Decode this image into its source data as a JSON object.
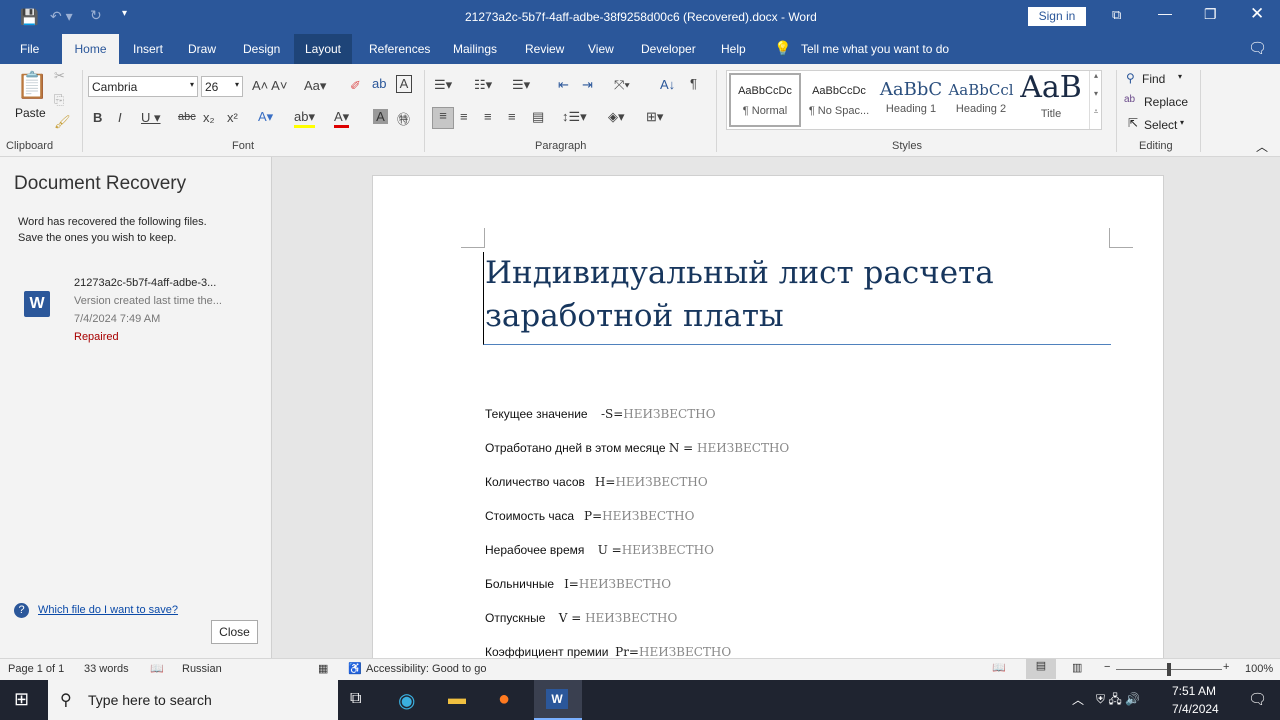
{
  "title": "21273a2c-5b7f-4aff-adbe-38f9258d00c6 (Recovered).docx  -  Word",
  "sign_in": "Sign in",
  "tabs": [
    "File",
    "Home",
    "Insert",
    "Draw",
    "Design",
    "Layout",
    "References",
    "Mailings",
    "Review",
    "View",
    "Developer",
    "Help"
  ],
  "tell_me": "Tell me what you want to do",
  "ribbon": {
    "paste": "Paste",
    "font_name": "Cambria",
    "font_size": "26",
    "groups": {
      "clipboard": "Clipboard",
      "font": "Font",
      "paragraph": "Paragraph",
      "styles": "Styles",
      "editing": "Editing"
    },
    "styles": [
      {
        "preview": "AaBbCcDc",
        "label": "¶ Normal"
      },
      {
        "preview": "AaBbCcDc",
        "label": "¶ No Spac..."
      },
      {
        "preview": "AaBbC",
        "label": "Heading 1"
      },
      {
        "preview": "AaBbCcl",
        "label": "Heading 2"
      },
      {
        "preview": "AaB",
        "label": "Title"
      }
    ],
    "find": "Find",
    "replace": "Replace",
    "select": "Select"
  },
  "recovery": {
    "title": "Document Recovery",
    "desc1": "Word has recovered the following files.",
    "desc2": "Save the ones you wish to keep.",
    "file_name": "21273a2c-5b7f-4aff-adbe-3...",
    "file_note": "Version created last time the...",
    "file_date": "7/4/2024 7:49 AM",
    "file_status": "Repaired",
    "help_link": "Which file do I want to save?",
    "close": "Close"
  },
  "document": {
    "title": "Индивидуальный лист расчета заработной платы",
    "lines": [
      {
        "label": "Текущее значение",
        "key": "-S=",
        "value": "НЕИЗВЕСТНО"
      },
      {
        "label": "Отработано дней в этом месяце",
        "key": "N = ",
        "value": "НЕИЗВЕСТНО"
      },
      {
        "label": "Количество часов",
        "key": "H=",
        "value": "НЕИЗВЕСТНО"
      },
      {
        "label": "Стоимость часа",
        "key": "P=",
        "value": "НЕИЗВЕСТНО"
      },
      {
        "label": "Нерабочее время",
        "key": "U =",
        "value": "НЕИЗВЕСТНО"
      },
      {
        "label": "Больничные",
        "key": "I=",
        "value": "НЕИЗВЕСТНО"
      },
      {
        "label": "Отпускные",
        "key": "V = ",
        "value": "НЕИЗВЕСТНО"
      },
      {
        "label": "Коэффициент премии",
        "key": "Pr=",
        "value": "НЕИЗВЕСТНО"
      }
    ]
  },
  "status": {
    "page": "Page 1 of 1",
    "words": "33 words",
    "language": "Russian",
    "accessibility": "Accessibility: Good to go",
    "zoom": "100%"
  },
  "taskbar": {
    "search": "Type here to search",
    "time": "7:51 AM",
    "date": "7/4/2024"
  }
}
